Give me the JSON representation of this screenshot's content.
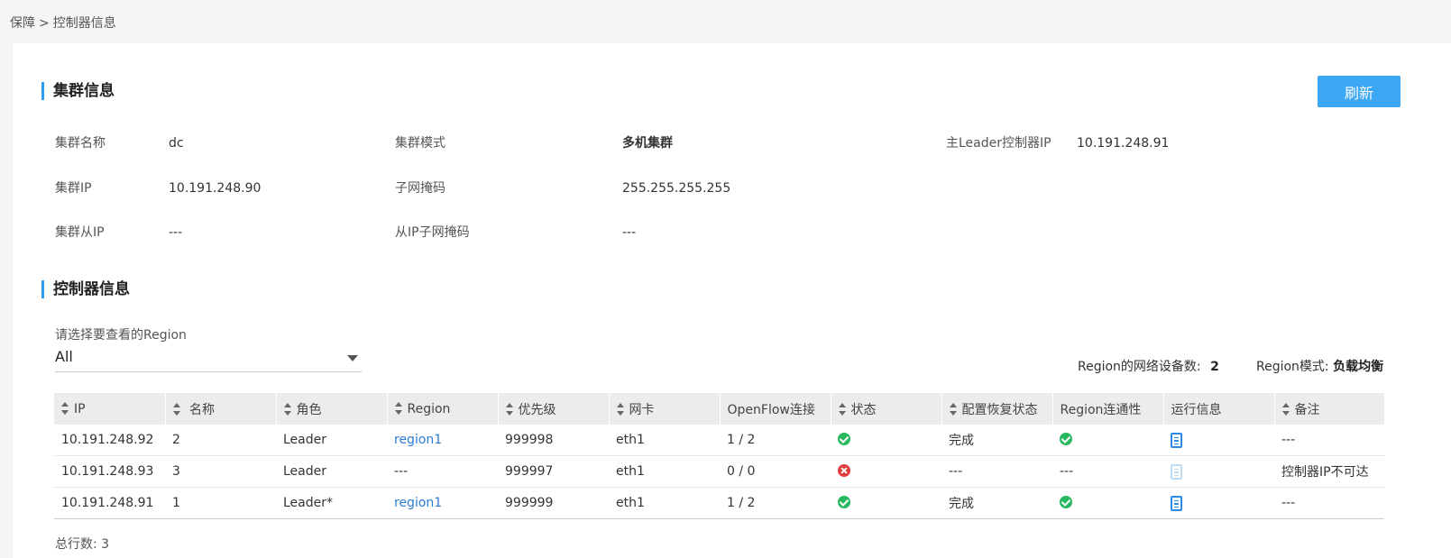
{
  "breadcrumb": {
    "parent": "保障",
    "separator": ">",
    "current": "控制器信息"
  },
  "cluster": {
    "title": "集群信息",
    "refresh_label": "刷新",
    "fields": {
      "name": {
        "label": "集群名称",
        "value": "dc"
      },
      "mode": {
        "label": "集群模式",
        "value": "多机集群"
      },
      "leader_ip": {
        "label": "主Leader控制器IP",
        "value": "10.191.248.91"
      },
      "ip": {
        "label": "集群IP",
        "value": "10.191.248.90"
      },
      "mask": {
        "label": "子网掩码",
        "value": "255.255.255.255"
      },
      "slave_ip": {
        "label": "集群从IP",
        "value": "---"
      },
      "slave_mask": {
        "label": "从IP子网掩码",
        "value": "---"
      }
    }
  },
  "controllers": {
    "title": "控制器信息",
    "region_select_label": "请选择要查看的Region",
    "region_selected": "All",
    "device_count_label": "Region的网络设备数:",
    "device_count": "2",
    "region_mode_label": "Region模式:",
    "region_mode": "负载均衡",
    "columns": [
      "IP",
      "名称",
      "角色",
      "Region",
      "优先级",
      "网卡",
      "OpenFlow连接",
      "状态",
      "配置恢复状态",
      "Region连通性",
      "运行信息",
      "备注"
    ],
    "rows": [
      {
        "ip": "10.191.248.92",
        "name": "2",
        "role": "Leader",
        "region": "region1",
        "priority": "999998",
        "nic": "eth1",
        "openflow": "1 / 2",
        "status": "ok",
        "restore": "完成",
        "connectivity": "ok",
        "runinfo": "enabled",
        "remark": "---"
      },
      {
        "ip": "10.191.248.93",
        "name": "3",
        "role": "Leader",
        "region": "---",
        "priority": "999997",
        "nic": "eth1",
        "openflow": "0 / 0",
        "status": "error",
        "restore": "---",
        "connectivity": "---",
        "runinfo": "disabled",
        "remark": "控制器IP不可达"
      },
      {
        "ip": "10.191.248.91",
        "name": "1",
        "role": "Leader*",
        "region": "region1",
        "priority": "999999",
        "nic": "eth1",
        "openflow": "1 / 2",
        "status": "ok",
        "restore": "完成",
        "connectivity": "ok",
        "runinfo": "enabled",
        "remark": "---"
      }
    ],
    "total_label": "总行数:",
    "total_value": "3"
  },
  "colors": {
    "accent": "#3ba7f5",
    "link": "#2b7cd3",
    "ok": "#27b860",
    "error": "#e53d3d"
  }
}
